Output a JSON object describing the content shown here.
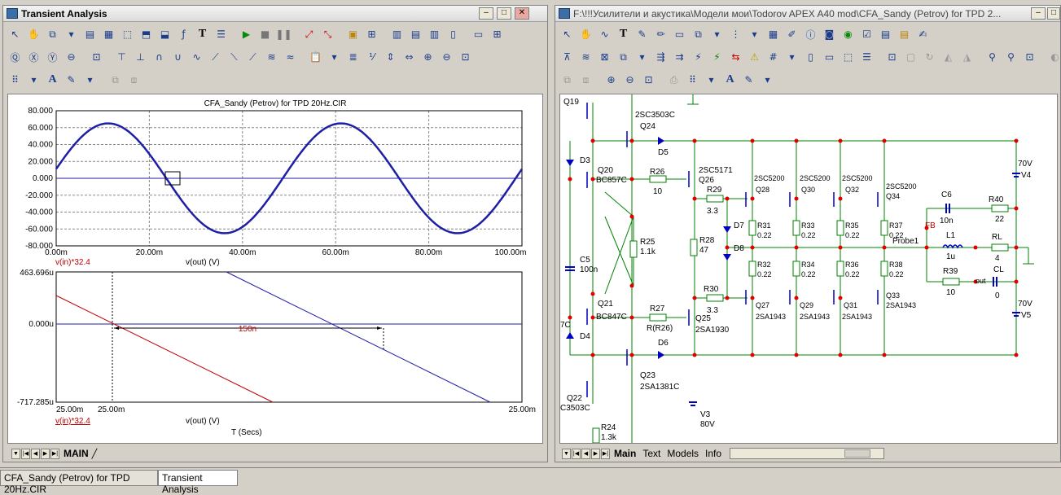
{
  "left_window": {
    "title": "Transient Analysis",
    "tab": "MAIN"
  },
  "right_window": {
    "title": "F:\\!!!Усилители и акустика\\Модели мои\\Todorov APEX A40 mod\\CFA_Sandy (Petrov) for TPD 2...",
    "tabs": [
      "Main",
      "Text",
      "Models",
      "Info"
    ]
  },
  "taskbar": {
    "items": [
      "CFA_Sandy (Petrov) for TPD 20Hz.CIR",
      "Transient Analysis"
    ]
  },
  "plot1": {
    "title": "CFA_Sandy (Petrov) for TPD 20Hz.CIR",
    "yticks": [
      "80.000",
      "60.000",
      "40.000",
      "20.000",
      "0.000",
      "-20.000",
      "-40.000",
      "-60.000",
      "-80.000"
    ],
    "xticks": [
      "0.00m",
      "20.00m",
      "40.00m",
      "60.00m",
      "80.00m",
      "100.00m"
    ],
    "legend_red": "v(in)*32.4",
    "legend_blue": "v(out) (V)"
  },
  "plot2": {
    "ytop": "463.696u",
    "ymid": "0.000u",
    "ybot": "-717.285u",
    "xleft": "25.00m",
    "xleft2": "25.00m",
    "xright": "25.00m",
    "delta_label": "150n",
    "legend_red": "v(in)*32.4",
    "legend_blue": "v(out) (V)",
    "xlabel": "T (Secs)"
  },
  "schematic": {
    "labels": {
      "q19": "Q19",
      "q24n": "2SC3503C",
      "q24": "Q24",
      "d5": "D5",
      "d3": "D3",
      "q20": "Q20",
      "q20t": "BC857C",
      "r26": "R26",
      "r26v": "10",
      "q26t": "2SC5171",
      "q26": "Q26",
      "r29": "R29",
      "r29v": "3.3",
      "c5": "C5",
      "c5v": "100n",
      "r25": "R25",
      "r25v": "1.1k",
      "r28": "R28",
      "r28v": "47",
      "d7": "D7",
      "d8": "D8",
      "r30": "R30",
      "r30v": "3.3",
      "q21": "Q21",
      "q21t": "BC847C",
      "r27": "R27",
      "r27v": "R(R26)",
      "q25": "Q25",
      "q25t": "2SA1930",
      "d4": "D4",
      "x7c": "7C",
      "d6": "D6",
      "q23": "Q23",
      "q23t": "2SA1381C",
      "q22": "Q22",
      "q22t": "C3503C",
      "r24": "R24",
      "r24v": "1.3k",
      "v3": "V3",
      "v3v": "80V",
      "q28t": "2SC5200",
      "q28": "Q28",
      "q30t": "2SC5200",
      "q30": "Q30",
      "q32t": "2SC5200",
      "q32": "Q32",
      "q34t": "2SC5200",
      "q34": "Q34",
      "r31": "R31",
      "r31v": "0.22",
      "r33": "R33",
      "r33v": "0.22",
      "r35": "R35",
      "r35v": "0.22",
      "r37": "R37",
      "r37v": "0.22",
      "r32": "R32",
      "r32v": "0.22",
      "r34": "R34",
      "r34v": "0.22",
      "r36": "R36",
      "r36v": "0.22",
      "r38": "R38",
      "r38v": "0.22",
      "q27": "Q27",
      "q27t": "2SA1943",
      "q29": "Q29",
      "q29t": "2SA1943",
      "q31": "Q31",
      "q31t": "2SA1943",
      "q33": "Q33",
      "q33t": "2SA1943",
      "c6": "C6",
      "c6v": "10n",
      "r40": "R40",
      "r40v": "22",
      "fb": "FB",
      "probe": "Probe1",
      "l1": "L1",
      "l1v": "1u",
      "rl": "RL",
      "rlv": "4",
      "r39": "R39",
      "r39v": "10",
      "cl": "CL",
      "clv": "0",
      "out": "out",
      "v4": "V4",
      "v4v": "70V",
      "v5": "V5",
      "v5v": "70V"
    }
  },
  "colors": {
    "trace_blue": "#1f1fa6",
    "trace_red": "#c00000",
    "schematic_green": "#008000",
    "node_red": "#e00000"
  }
}
